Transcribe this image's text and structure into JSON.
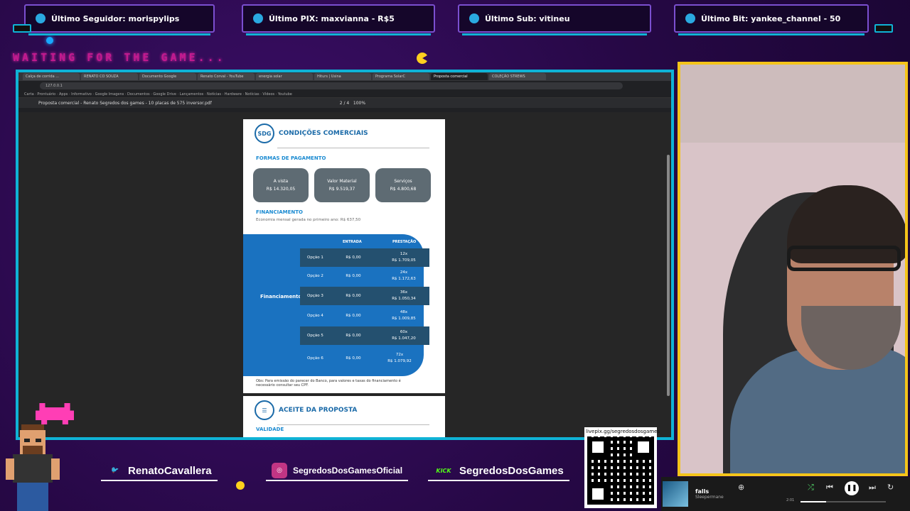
{
  "alerts": [
    {
      "label": "Último Seguidor: morispylips",
      "icon": "person-icon",
      "color": "#2aa9e0"
    },
    {
      "label": "Último PIX: maxvianna - R$5",
      "icon": "dollar-icon",
      "color": "#2aa9e0"
    },
    {
      "label": "Último Sub: vitineu",
      "icon": "star-icon",
      "color": "#2aa9e0"
    },
    {
      "label": "Último Bit: yankee_channel - 50",
      "icon": "gem-icon",
      "color": "#2aa9e0"
    }
  ],
  "waiting_text": "WAITING FOR THE GAME...",
  "browser": {
    "tabs": [
      "Calça de corrida ...",
      "RENATO CO SOUZA",
      "Documento Google",
      "Renato Corval - YouTube",
      "energia solar",
      "Hiturs | Usina",
      "Programa SolarC",
      "Proposta comercial",
      "COLEÇÃO STREWS"
    ],
    "url": "127.0.0.1",
    "bookmarks": "Carta · Prontuário · Apps · Informativo · Google Imagens · Documentos · Google Drive · Lançamentos · Notícias · Hardware · Notícias · Vídeos · Youtube",
    "pdf_title": "Proposta comercial - Renato Segredos dos games - 10 placas de 575 inversor.pdf",
    "page_num": "2",
    "page_total": "/ 4",
    "zoom": "100%"
  },
  "proposal": {
    "logo": "SDG",
    "title": "CONDIÇÕES COMERCIAIS",
    "payment_heading": "FORMAS DE PAGAMENTO",
    "options": [
      {
        "label": "A vista",
        "value": "R$ 14.320,05"
      },
      {
        "label": "Valor Material",
        "value": "R$ 9.519,37"
      },
      {
        "label": "Serviços",
        "value": "R$ 4.800,68"
      }
    ],
    "financing_heading": "FINANCIAMENTO",
    "economy_note": "Economia mensal gerada no primeiro ano:",
    "economy_value": "R$ 637,50",
    "fin_label": "Financiamento BV",
    "col_entrada": "ENTRADA",
    "col_prestacao": "PRESTAÇÃO",
    "rows": [
      {
        "opt": "Opção 1",
        "entry": "R$ 0,00",
        "term": "12x",
        "amount": "R$ 1.709,05"
      },
      {
        "opt": "Opção 2",
        "entry": "R$ 0,00",
        "term": "24x",
        "amount": "R$ 1.172,63"
      },
      {
        "opt": "Opção 3",
        "entry": "R$ 0,00",
        "term": "36x",
        "amount": "R$ 1.050,34"
      },
      {
        "opt": "Opção 4",
        "entry": "R$ 0,00",
        "term": "48x",
        "amount": "R$ 1.009,85"
      },
      {
        "opt": "Opção 5",
        "entry": "R$ 0,00",
        "term": "60x",
        "amount": "R$ 1.047,20"
      },
      {
        "opt": "Opção 6",
        "entry": "R$ 0,00",
        "term": "72x",
        "amount": "R$ 1.079,92"
      }
    ],
    "footnote": "Obs: Para emissão do parecer do Banco, para valores e taxas do financiamento é necessário consultar seu CPF.",
    "accept_title": "ACEITE DA PROPOSTA",
    "validade": "VALIDADE"
  },
  "socials": [
    {
      "handle": "RenatoCavallera",
      "icon": "twitter-icon",
      "color": "#1da1f2"
    },
    {
      "handle": "SegredosDosGamesOficial",
      "icon": "instagram-icon",
      "color": "#c13584"
    },
    {
      "handle": "SegredosDosGames",
      "icon": "kick-icon",
      "color": "#53fc18"
    }
  ],
  "qr": {
    "caption": "livepix.gg/segredosdosgames"
  },
  "player": {
    "title": "falls",
    "artist": "Sleepermane",
    "elapsed": "2:01",
    "progress": 0.3
  }
}
